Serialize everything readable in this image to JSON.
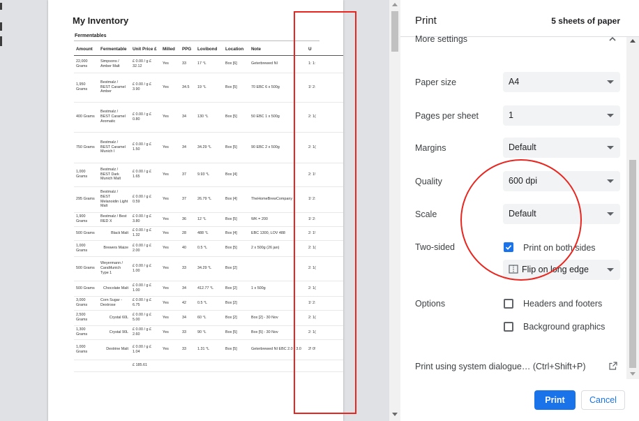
{
  "preview": {
    "document": {
      "title": "My Inventory",
      "section": "Fermentables",
      "columns": [
        "Amount",
        "Fermentable",
        "Unit Price £",
        "Milled",
        "PPG",
        "Lovibond",
        "Location",
        "Note",
        "U"
      ],
      "rows": [
        [
          "22,000 Grams",
          "Simpsons / Amber Malt",
          "£ 0.00 / g £ 32.12",
          "Yes",
          "33",
          "17 °L",
          "Box [6]",
          "Geterbrewed NI",
          "1: 1:"
        ],
        [
          "1,950 Grams",
          "Bestmalz / BEST Caramel Amber",
          "£ 0.00 / g £ 3.90",
          "Yes",
          "34.5",
          "19 °L",
          "Box [5]",
          "70 EBC 6 x 500g",
          "1! 2:"
        ],
        [
          "400 Grams",
          "Bestmalz / BEST Caramel Aromatic",
          "£ 0.00 / g £ 0.80",
          "Yes",
          "34",
          "130 °L",
          "Box [5]",
          "50 EBC 1 x 500g",
          "2: 1("
        ],
        [
          "750 Grams",
          "Bestmalz / BEST Caramel Munich I",
          "£ 0.00 / g £ 1.50",
          "Yes",
          "34",
          "34.29 °L",
          "Box [5]",
          "90 EBC 2 x 500g",
          "2: 1("
        ],
        [
          "1,000 Grams",
          "Bestmalz / BEST Dark Munich Malt",
          "£ 0.00 / g £ 1.65",
          "Yes",
          "37",
          "9.93 °L",
          "Box [4]",
          "",
          "2: 1!"
        ],
        [
          "295 Grams",
          "Bestmalz / BEST Melanoidin Light Malt",
          "£ 0.00 / g £ 0.59",
          "Yes",
          "37",
          "26.79 °L",
          "Box [4]",
          "TheHomeBrewCompany",
          "1! 2:"
        ],
        [
          "1,900 Grams",
          "Bestmalz / Best RED X",
          "£ 0.00 / g £ 3.80",
          "Yes",
          "36",
          "12 °L",
          "Box [5]",
          "WK = 200",
          "1! 2:"
        ],
        [
          "500 Grams",
          "Black Malt",
          "£ 0.00 / g £ 1.32",
          "Yes",
          "28",
          "488 °L",
          "Box [4]",
          "EBC 1300, LOV 488",
          "2: 1!"
        ],
        [
          "1,000 Grams",
          "Brewers Maize",
          "£ 0.00 / g £ 2.00",
          "Yes",
          "40",
          "0.5 °L",
          "Box [5]",
          "2 x 500g (26 jan)",
          "2: 1("
        ],
        [
          "500 Grams",
          "Weyermann / CaraMunich Type 1",
          "£ 0.00 / g £ 1.00",
          "Yes",
          "33",
          "34.29 °L",
          "Box [2]",
          "",
          "2: 1("
        ],
        [
          "500 Grams",
          "Chocolate Malt",
          "£ 0.00 / g £ 1.00",
          "Yes",
          "34",
          "412.77 °L",
          "Box [2]",
          "1 x 500g",
          "2: 1("
        ],
        [
          "3,000 Grams",
          "Corn Sugar - Dextrose",
          "£ 0.00 / g £ 6.75",
          "Yes",
          "42",
          "0.5 °L",
          "Box [2]",
          "",
          "1! 2:"
        ],
        [
          "2,500 Grams",
          "Crystal 60L",
          "£ 0.00 / g £ 5.00",
          "Yes",
          "34",
          "60 °L",
          "Box [2]",
          "Box [2] - 30 Nov",
          "2: 1("
        ],
        [
          "1,300 Grams",
          "Crystal 90L",
          "£ 0.00 / g £ 2.60",
          "Yes",
          "33",
          "90 °L",
          "Box [5]",
          "Box [5] - 30 Nov",
          "2: 1("
        ],
        [
          "1,000 Grams",
          "Dextrine Malt",
          "£ 0.00 / g £ 1.04",
          "Yes",
          "33",
          "1.31 °L",
          "Box [5]",
          "Geterbrewed NI EBC 2.0 - 3.0",
          "2! 0!"
        ],
        [
          "",
          "",
          "£ 185.61",
          "",
          "",
          "",
          "",
          "",
          ""
        ]
      ]
    }
  },
  "settings": {
    "title": "Print",
    "sheet_count": "5 sheets of paper",
    "more_settings_label": "More settings",
    "paper_size": {
      "label": "Paper size",
      "value": "A4"
    },
    "pages_per_sheet": {
      "label": "Pages per sheet",
      "value": "1"
    },
    "margins": {
      "label": "Margins",
      "value": "Default"
    },
    "quality": {
      "label": "Quality",
      "value": "600 dpi"
    },
    "scale": {
      "label": "Scale",
      "value": "Default"
    },
    "two_sided": {
      "label": "Two-sided",
      "checkbox_label": "Print on both sides",
      "checked": true,
      "flip_value": "Flip on long edge"
    },
    "options": {
      "label": "Options",
      "headers_footers": {
        "label": "Headers and footers",
        "checked": false
      },
      "background_graphics": {
        "label": "Background graphics",
        "checked": false
      }
    },
    "system_dialog_link": "Print using system dialogue… (Ctrl+Shift+P)",
    "print_button": "Print",
    "cancel_button": "Cancel"
  },
  "icons": {
    "more_settings_chevron": "chevron-up-icon",
    "flip": "flip-long-edge-icon",
    "open_external": "open-external-icon",
    "checkmark": "checkmark-icon"
  },
  "colors": {
    "accent": "#1a73e8",
    "annotation": "#e8251e",
    "preview_background": "#dfe1e5",
    "select_background": "#f1f3f4"
  }
}
